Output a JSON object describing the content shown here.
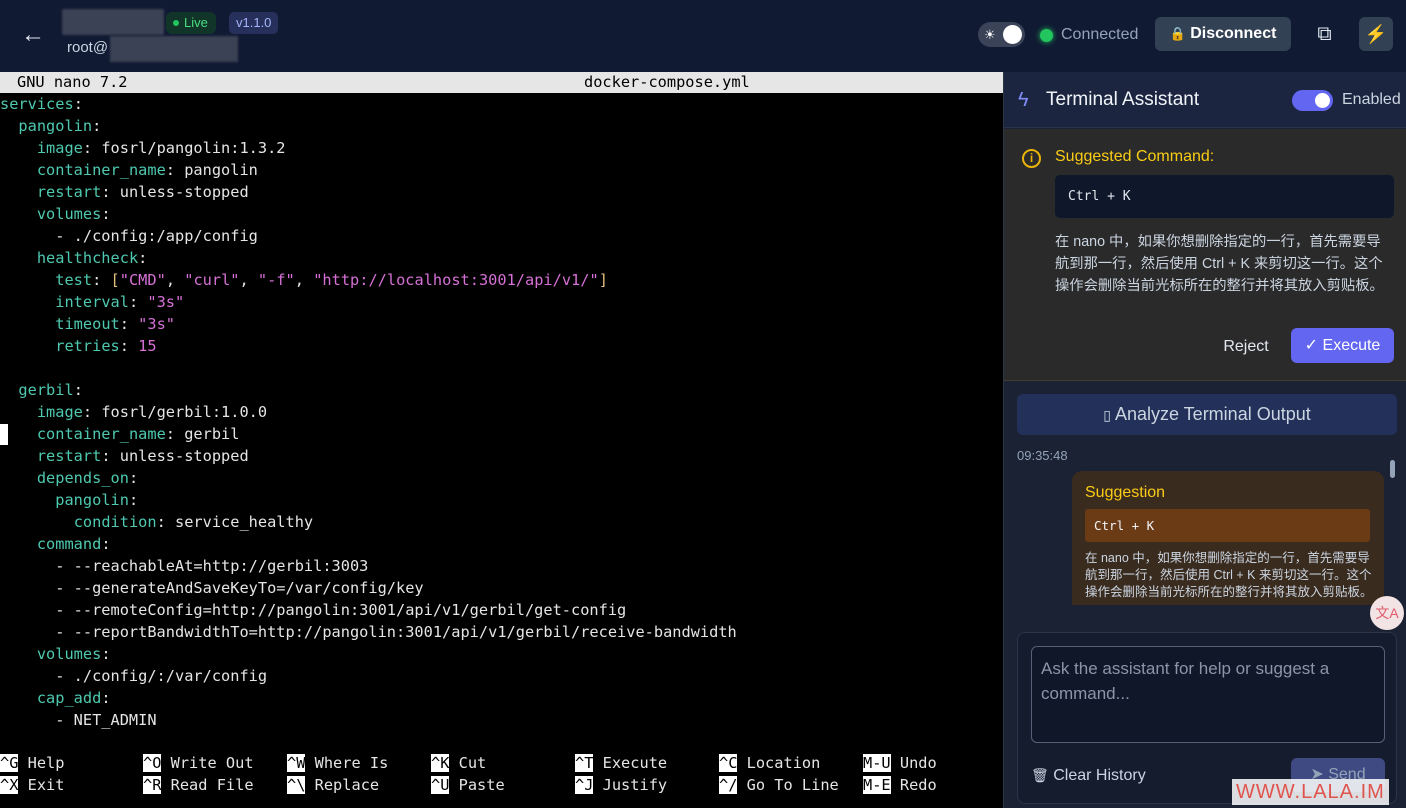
{
  "header": {
    "live_label": "Live",
    "version": "v1.1.0",
    "user_prefix": "root@",
    "theme_icon": "☀",
    "connection_status": "Connected",
    "disconnect_label": "Disconnect",
    "icons": {
      "back": "←",
      "lock": "🔒",
      "copy": "⧉",
      "zap": "⚡"
    }
  },
  "terminal": {
    "nano_version": "GNU nano 7.2",
    "filename": "docker-compose.yml",
    "shortcuts": [
      {
        "key": "^G",
        "label": "Help"
      },
      {
        "key": "^X",
        "label": "Exit"
      },
      {
        "key": "^O",
        "label": "Write Out"
      },
      {
        "key": "^R",
        "label": "Read File"
      },
      {
        "key": "^W",
        "label": "Where Is"
      },
      {
        "key": "^\\",
        "label": "Replace"
      },
      {
        "key": "^K",
        "label": "Cut"
      },
      {
        "key": "^U",
        "label": "Paste"
      },
      {
        "key": "^T",
        "label": "Execute"
      },
      {
        "key": "^J",
        "label": "Justify"
      },
      {
        "key": "^C",
        "label": "Location"
      },
      {
        "key": "^/",
        "label": "Go To Line"
      },
      {
        "key": "M-U",
        "label": "Undo"
      },
      {
        "key": "M-E",
        "label": "Redo"
      }
    ]
  },
  "assistant": {
    "title": "Terminal Assistant",
    "enabled_label": "Enabled",
    "suggested_label": "Suggested Command:",
    "suggested_command": "Ctrl + K",
    "suggested_desc": "在 nano 中，如果你想删除指定的一行，首先需要导航到那一行，然后使用 Ctrl + K 来剪切这一行。这个操作会删除当前光标所在的整行并将其放入剪贴板。",
    "reject_label": "Reject",
    "execute_label": "Execute",
    "analyze_label": "Analyze Terminal Output",
    "timestamp": "09:35:48",
    "bubble_title": "Suggestion",
    "bubble_command": "Ctrl + K",
    "bubble_desc": "在 nano 中，如果你想删除指定的一行，首先需要导航到那一行，然后使用 Ctrl + K 来剪切这一行。这个操作会删除当前光标所在的整行并将其放入剪贴板。",
    "input_placeholder": "Ask the assistant for help or suggest a command...",
    "clear_label": "Clear History",
    "send_label": "Send",
    "translate_icon": "文A"
  },
  "watermark": "WWW.LALA.IM"
}
